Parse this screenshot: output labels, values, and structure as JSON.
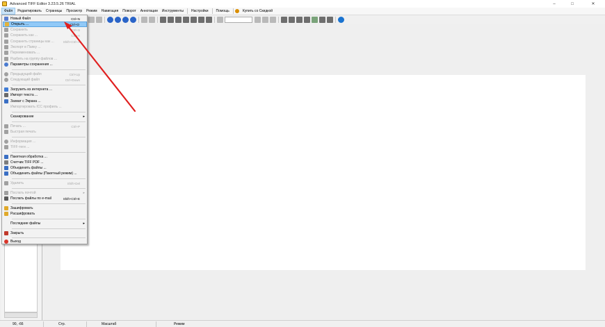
{
  "window": {
    "title": "Advanced TIFF Editor 3.23.5.26 TRIAL",
    "minimize": "–",
    "maximize": "□",
    "close": "✕"
  },
  "menubar": {
    "items": [
      "Файл",
      "Редактировать",
      "Страницы",
      "Просмотр",
      "Режим",
      "Навигация",
      "Поворот",
      "Аннотации",
      "Инструменты",
      "Настройки",
      "Помощь",
      "Купить со Скидкой"
    ]
  },
  "file_menu": {
    "items": [
      {
        "label": "Новый Файл",
        "shortcut": "Ctrl+N",
        "disabled": false,
        "icon_color": "#5b7fcf"
      },
      {
        "label": "Открыть ...",
        "shortcut": "Ctrl+O",
        "disabled": false,
        "highlighted": true,
        "icon_color": "#e3b23c"
      },
      {
        "label": "Сохранить",
        "shortcut": "Ctrl+S",
        "disabled": true,
        "icon_color": "#a0a0a0"
      },
      {
        "label": "Сохранить как ...",
        "shortcut": "Ctrl+A",
        "disabled": true,
        "icon_color": "#a0a0a0"
      },
      {
        "label": "Сохранить страницы как ...",
        "shortcut": "Shift+Ctrl+A",
        "disabled": true,
        "icon_color": "#a0a0a0"
      },
      {
        "label": "Экспорт в Папку ...",
        "shortcut": "",
        "disabled": true,
        "icon_color": "#a0a0a0"
      },
      {
        "label": "Переименовать ...",
        "shortcut": "",
        "disabled": true,
        "icon_color": "#a0a0a0"
      },
      {
        "label": "Разбить на группу файлов ...",
        "shortcut": "",
        "disabled": true,
        "icon_color": "#a0a0a0"
      },
      {
        "label": "Параметры сохранения ...",
        "shortcut": "",
        "disabled": false,
        "icon_color": "#4a7bd0"
      },
      {
        "label": "Предыдущий файл",
        "shortcut": "Ctrl+Up",
        "disabled": true,
        "icon_color": "#a0a0a0"
      },
      {
        "label": "Следующий файл",
        "shortcut": "Ctrl+Down",
        "disabled": true,
        "icon_color": "#a0a0a0"
      },
      {
        "label": "Загрузить из интернета ...",
        "shortcut": "",
        "disabled": false,
        "icon_color": "#3f7cd6"
      },
      {
        "label": "Импорт текста ...",
        "shortcut": "",
        "disabled": false,
        "icon_color": "#6a6a6a"
      },
      {
        "label": "Захват с Экрана ...",
        "shortcut": "",
        "disabled": false,
        "icon_color": "#3a6fc4"
      },
      {
        "label": "Импортировать ICC профиль ...",
        "shortcut": "",
        "disabled": true,
        "icon_color": "none"
      },
      {
        "label": "Сканирование",
        "shortcut": "",
        "disabled": false,
        "submenu": true,
        "icon_color": "none"
      },
      {
        "label": "Печать ...",
        "shortcut": "Ctrl+P",
        "disabled": true,
        "icon_color": "#a0a0a0"
      },
      {
        "label": "Быстрая печать",
        "shortcut": "",
        "disabled": true,
        "icon_color": "#a0a0a0"
      },
      {
        "label": "Информация ...",
        "shortcut": "",
        "disabled": true,
        "icon_color": "#a0a0a0"
      },
      {
        "label": "TIFF-теги ...",
        "shortcut": "",
        "disabled": true,
        "icon_color": "#a0a0a0"
      },
      {
        "label": "Пакетная обработка ...",
        "shortcut": "",
        "disabled": false,
        "icon_color": "#3a6fc4"
      },
      {
        "label": "Счетчик TIFF PDF ...",
        "shortcut": "",
        "disabled": false,
        "icon_color": "#7d7d7d"
      },
      {
        "label": "Объединить файлы ...",
        "shortcut": "",
        "disabled": false,
        "icon_color": "#3a6fc4"
      },
      {
        "label": "Объединить файлы (Пакетный режим) ...",
        "shortcut": "",
        "disabled": false,
        "icon_color": "#3a6fc4"
      },
      {
        "label": "Удалить",
        "shortcut": "Shift+Del",
        "disabled": true,
        "icon_color": "#a0a0a0"
      },
      {
        "label": "Послать почтой",
        "shortcut": "",
        "disabled": true,
        "submenu": true,
        "icon_color": "#a0a0a0"
      },
      {
        "label": "Послать файлы по e-mail",
        "shortcut": "Shift+Ctrl+E",
        "disabled": false,
        "icon_color": "#5a5a5a"
      },
      {
        "label": "Зашифровать",
        "shortcut": "",
        "disabled": false,
        "icon_color": "#e0a92a"
      },
      {
        "label": "Расшифровать",
        "shortcut": "",
        "disabled": false,
        "icon_color": "#e0a92a"
      },
      {
        "label": "Последние файлы",
        "shortcut": "",
        "disabled": false,
        "submenu": true,
        "icon_color": "none"
      },
      {
        "label": "Закрыть",
        "shortcut": "",
        "disabled": false,
        "icon_color": "#c0392b"
      },
      {
        "label": "Выход",
        "shortcut": "",
        "disabled": false,
        "icon_color": "#d9362b"
      }
    ]
  },
  "statusbar": {
    "coords": "90, -66",
    "page_label": "Стр.",
    "scale_label": "Масштаб",
    "mode_label": "Режим"
  },
  "accent_color": "#e02020"
}
